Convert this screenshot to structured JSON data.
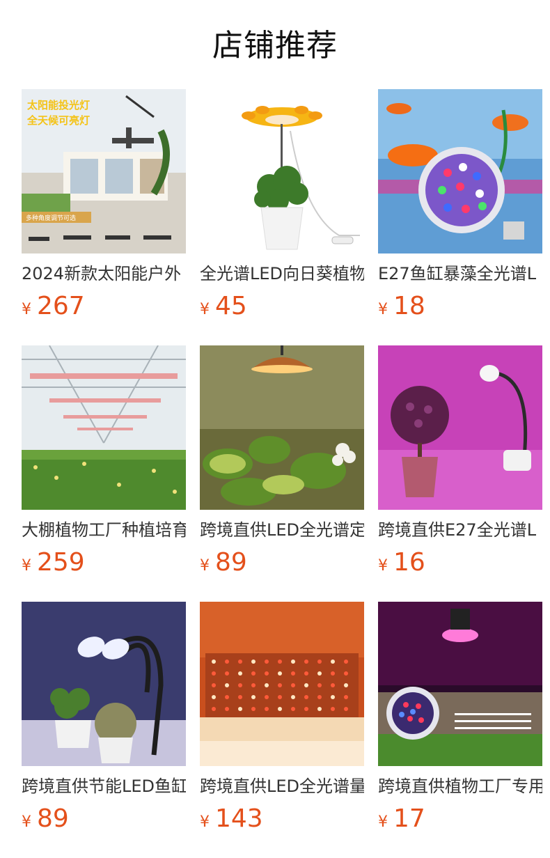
{
  "page": {
    "title": "店铺推荐"
  },
  "products": [
    {
      "name": "2024新款太阳能户外",
      "currency": "¥",
      "price": "267",
      "image": "solar-light-image",
      "overlay": [
        "太阳能投光灯",
        "全天候可亮灯"
      ],
      "badge": "多种角度调节可选"
    },
    {
      "name": "全光谱LED向日葵植物",
      "currency": "¥",
      "price": "45",
      "image": "sunflower-lamp-image"
    },
    {
      "name": "E27鱼缸暴藻全光谱L",
      "currency": "¥",
      "price": "18",
      "image": "aquarium-bulb-image"
    },
    {
      "name": "大棚植物工厂种植培育",
      "currency": "¥",
      "price": "259",
      "image": "greenhouse-image"
    },
    {
      "name": "跨境直供LED全光谱定",
      "currency": "¥",
      "price": "89",
      "image": "pendant-lamp-image"
    },
    {
      "name": "跨境直供E27全光谱L",
      "currency": "¥",
      "price": "16",
      "image": "clip-lamp-image"
    },
    {
      "name": "跨境直供节能LED鱼缸",
      "currency": "¥",
      "price": "89",
      "image": "dual-head-lamp-image"
    },
    {
      "name": "跨境直供LED全光谱量",
      "currency": "¥",
      "price": "143",
      "image": "led-panel-image"
    },
    {
      "name": "跨境直供植物工厂专用",
      "currency": "¥",
      "price": "17",
      "image": "grow-bulb-image"
    }
  ]
}
